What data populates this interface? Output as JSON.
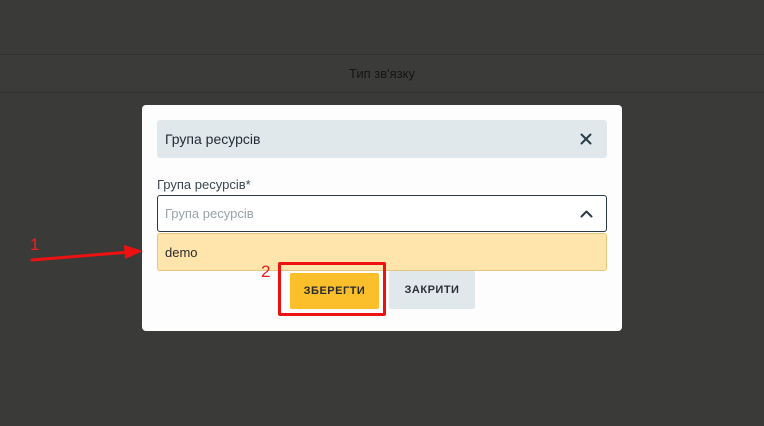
{
  "background": {
    "header_text": "Тип зв'язку"
  },
  "modal": {
    "title": "Група ресурсів",
    "field_label": "Група ресурсів*",
    "select_placeholder": "Група ресурсів",
    "options": [
      "demo"
    ],
    "save_label": "ЗБЕРЕГТИ",
    "close_label": "ЗАКРИТИ"
  },
  "annotations": {
    "label_1": "1",
    "label_2": "2",
    "color": "#ee1111"
  },
  "icons": {
    "close": "close-icon",
    "chevron": "chevron-up-icon"
  },
  "colors": {
    "accent": "#fbbf2b",
    "option_highlight": "#ffe5ab",
    "header_bg": "#e1e8ec"
  }
}
